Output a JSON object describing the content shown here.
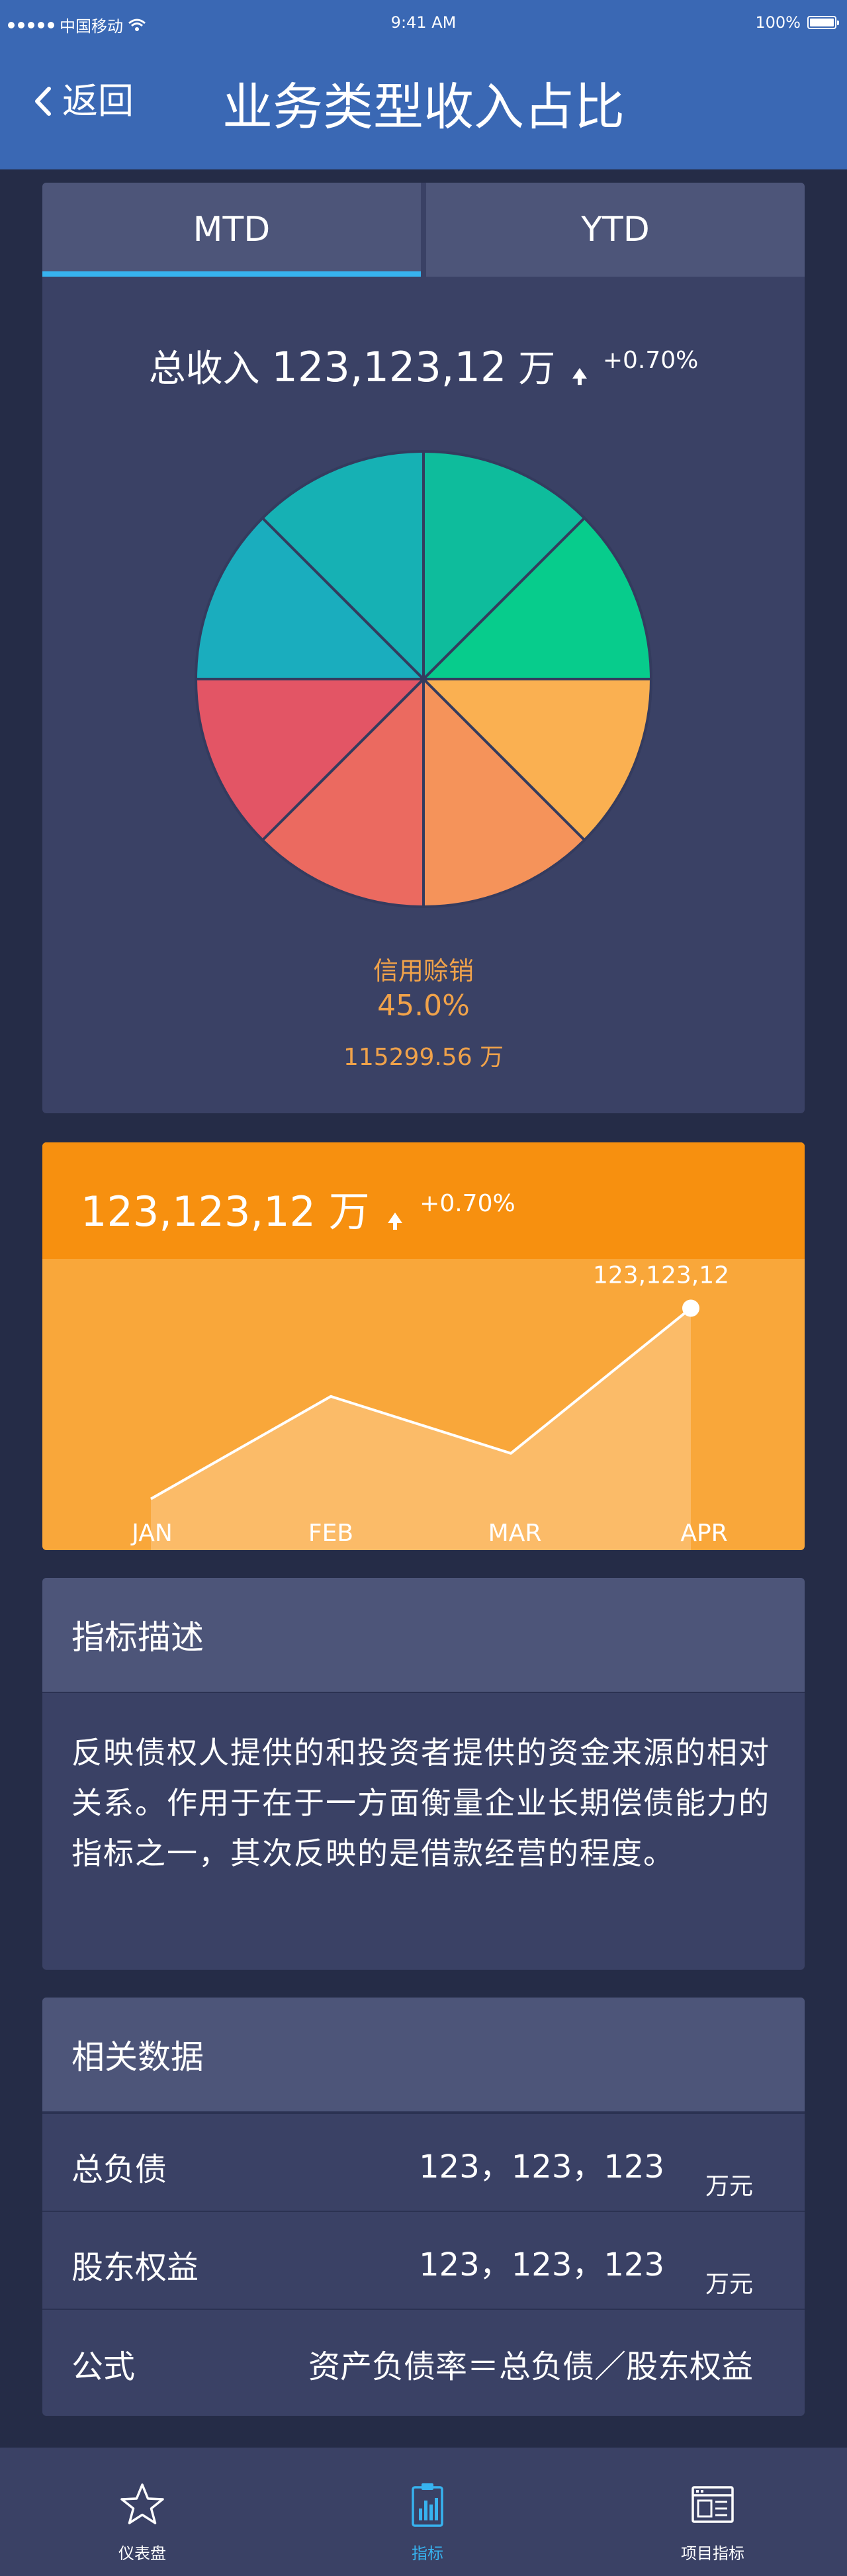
{
  "status_bar": {
    "carrier": "中国移动",
    "time": "9:41 AM",
    "battery": "100%"
  },
  "header": {
    "back_label": "返回",
    "title": "业务类型收入占比"
  },
  "tabs": [
    {
      "label": "MTD",
      "active": true
    },
    {
      "label": "YTD",
      "active": false
    }
  ],
  "summary": {
    "total_label": "总收入",
    "total_value": "123,123,12",
    "unit": "万",
    "change": "+0.70%"
  },
  "pie": {
    "colors": [
      "#0ebc9c",
      "#07cc8c",
      "#fab051",
      "#f5935a",
      "#eb6a60",
      "#e35565",
      "#1aadbe",
      "#16b1b4"
    ],
    "selected": {
      "category": "信用赊销",
      "percent": "45.0%",
      "amount": "115299.56 万"
    }
  },
  "trend": {
    "total_value": "123,123,12",
    "unit": "万",
    "change": "+0.70%",
    "peak_label": "123,123,12"
  },
  "chart_data": {
    "type": "area",
    "categories": [
      "JAN",
      "FEB",
      "MAR",
      "APR"
    ],
    "values": [
      0.18,
      0.54,
      0.34,
      0.85
    ],
    "ylim": [
      0,
      1
    ],
    "grid": false,
    "annotations": [
      "123,123,12"
    ]
  },
  "description": {
    "title": "指标描述",
    "text": "反映债权人提供的和投资者提供的资金来源的相对关系。作用于在于一方面衡量企业长期偿债能力的指标之一，其次反映的是借款经营的程度。"
  },
  "related": {
    "title": "相关数据",
    "rows": [
      {
        "label": "总负债",
        "value": "123，123，123",
        "unit": "万元"
      },
      {
        "label": "股东权益",
        "value": "123，123，123",
        "unit": "万元"
      }
    ],
    "formula": {
      "label": "公式",
      "value": "资产负债率＝总负债／股东权益"
    }
  },
  "tabbar": [
    {
      "label": "仪表盘",
      "icon": "star-icon",
      "active": false
    },
    {
      "label": "指标",
      "icon": "clipboard-chart-icon",
      "active": true
    },
    {
      "label": "项目指标",
      "icon": "browser-window-icon",
      "active": false
    }
  ],
  "tabbar_colors": {
    "active": "#37b3ef",
    "inactive": "#ffffff"
  }
}
